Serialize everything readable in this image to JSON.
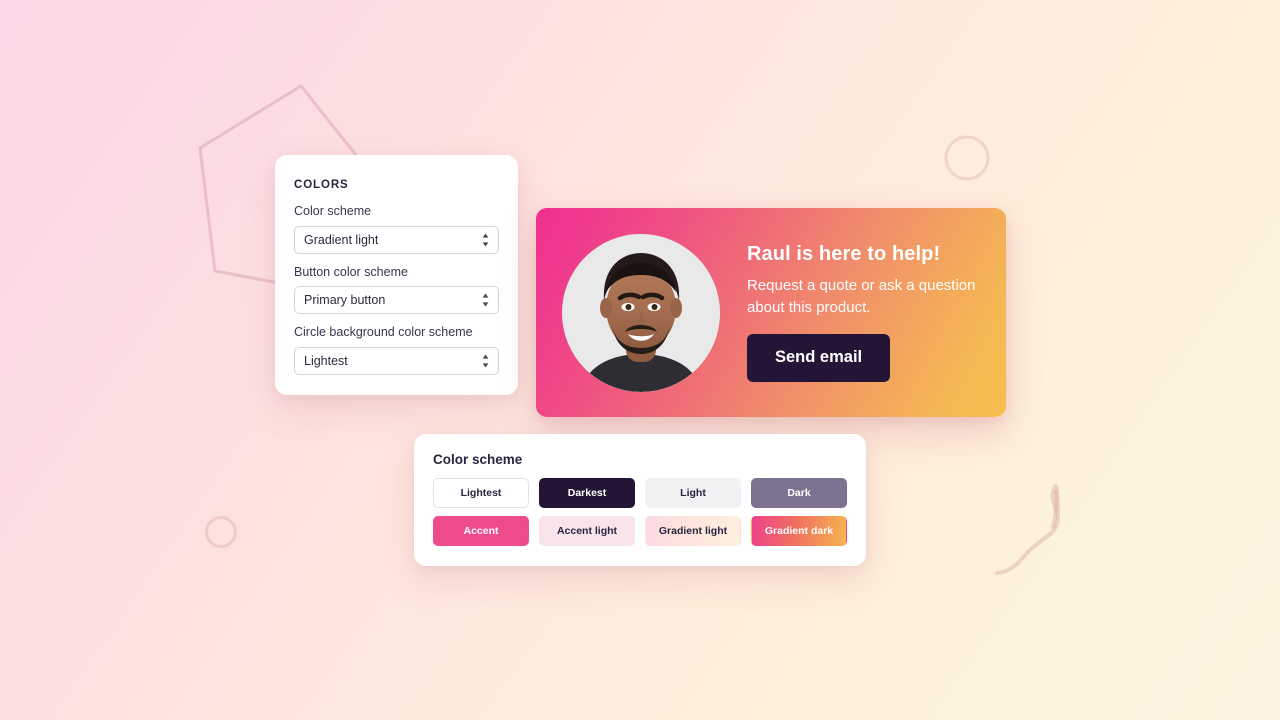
{
  "page": {
    "background_start": "#fad7e6",
    "background_end": "#fdf3e0"
  },
  "decor": {
    "pentagon": "pentagon-outline",
    "circle_top_right": "circle-outline",
    "circle_bottom_left": "circle-outline",
    "squiggle": "squiggle-line"
  },
  "settings": {
    "eyebrow": "COLORS",
    "fields": [
      {
        "label": "Color scheme",
        "value": "Gradient light",
        "name": "color-scheme-select"
      },
      {
        "label": "Button color scheme",
        "value": "Primary button",
        "name": "button-color-scheme-select"
      },
      {
        "label": "Circle background color scheme",
        "value": "Lightest",
        "name": "circle-background-color-scheme-select"
      }
    ]
  },
  "promo": {
    "title": "Raul is here to help!",
    "text": "Request a quote or ask a question about this product.",
    "button_label": "Send email",
    "button_color": "#241537",
    "gradient_start": "#f0308f",
    "gradient_end": "#f7be4e",
    "avatar_alt": "avatar-photo"
  },
  "palette": {
    "title": "Color scheme",
    "swatches": [
      {
        "label": "Lightest",
        "bg": "#ffffff",
        "fg": "#2b2340",
        "border": "#e4e1ea"
      },
      {
        "label": "Darkest",
        "bg": "#241537",
        "fg": "#ffffff",
        "border": "#241537"
      },
      {
        "label": "Light",
        "bg": "#f2f2f4",
        "fg": "#2b2340",
        "border": "#f2f2f4"
      },
      {
        "label": "Dark",
        "bg": "#7d7391",
        "fg": "#ffffff",
        "border": "#7d7391"
      },
      {
        "label": "Accent",
        "bg": "#ed4b8c",
        "fg": "#ffffff",
        "border": "#ed4b8c"
      },
      {
        "label": "Accent light",
        "bg": "#f9e4ea",
        "fg": "#2b2340",
        "border": "#f9e4ea"
      },
      {
        "label": "Gradient light",
        "bg": "linear-gradient(100deg,#fcd9e3 0%,#fde6dd 50%,#fdf0dd 100%)",
        "fg": "#2b2340",
        "border": "transparent"
      },
      {
        "label": "Gradient dark",
        "bg": "linear-gradient(100deg,#ee3f8c 0%,#f0705f 45%,#f6b44f 100%)",
        "fg": "#ffffff",
        "border": "transparent"
      }
    ]
  }
}
